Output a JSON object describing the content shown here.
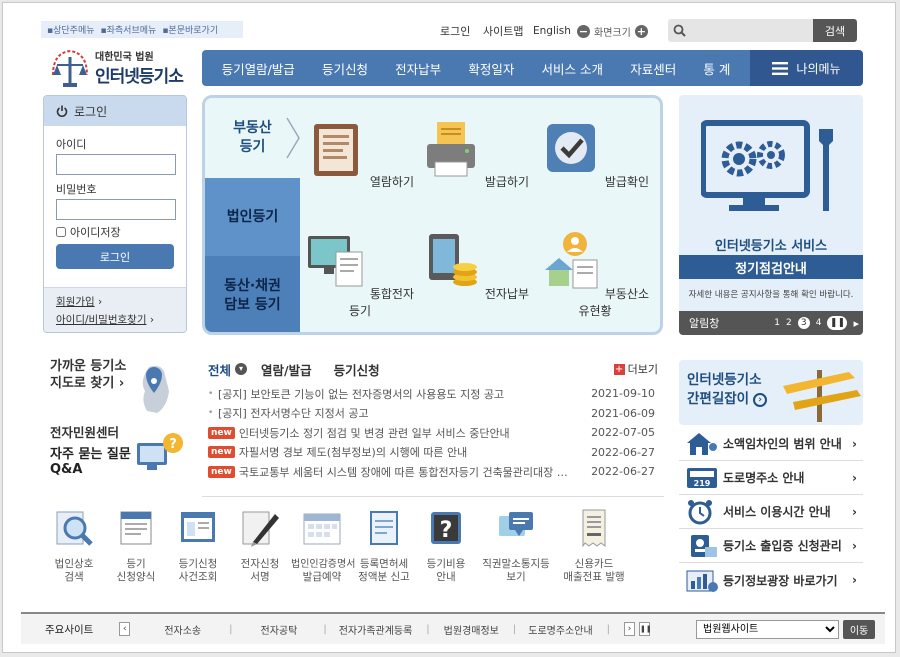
{
  "skip_links": [
    "상단주메뉴",
    "좌측서브메뉴",
    "본문바로가기"
  ],
  "utility": {
    "login": "로그인",
    "sitemap": "사이트맵",
    "english": "English",
    "zoom_label": "화면크기",
    "search_button": "검색",
    "search_placeholder": ""
  },
  "logo": {
    "top": "대한민국 법원",
    "main": "인터넷등기소"
  },
  "gnb": [
    "등기열람/발급",
    "등기신청",
    "전자납부",
    "확정일자",
    "서비스 소개",
    "자료센터",
    "통 계"
  ],
  "my_menu": "나의메뉴",
  "login_box": {
    "title": "로그인",
    "id_label": "아이디",
    "pw_label": "비밀번호",
    "save_id": "아이디저장",
    "button": "로그인",
    "join": "회원가입",
    "find": "아이디/비밀번호찾기"
  },
  "center": {
    "tabs": [
      "부동산\n등기",
      "법인등기",
      "동산·채권\n담보 등기"
    ],
    "services": [
      "열람하기",
      "발급하기",
      "발급확인",
      "통합전자등기",
      "전자납부",
      "부동산소유현황"
    ]
  },
  "banner": {
    "title": "인터넷등기소 서비스",
    "subtitle": "정기점검안내",
    "desc": "자세한 내용은 공지사항을 통해 확인 바랍니다.",
    "notice": "알림창",
    "pages": [
      "1",
      "2",
      "3",
      "4"
    ]
  },
  "near": {
    "line1": "가까운 등기소",
    "line2": "지도로 찾기"
  },
  "help": {
    "line1": "전자민원센터",
    "line2": "자주 묻는 질문",
    "line3": "Q&A"
  },
  "news": {
    "tabs": [
      "전체",
      "열람/발급",
      "등기신청"
    ],
    "more": "더보기",
    "items": [
      {
        "new": false,
        "title": "[공지] 보안토큰 기능이 없는 전자증명서의 사용용도 지정 공고",
        "date": "2021-09-10"
      },
      {
        "new": false,
        "title": "[공지] 전자서명수단 지정서 공고",
        "date": "2021-06-09"
      },
      {
        "new": true,
        "title": "인터넷등기소 정기 점검 및 변경 관련 일부 서비스 중단안내",
        "date": "2022-07-05"
      },
      {
        "new": true,
        "title": "자필서명 경보 제도(첨부정보)의 시행에 따른 안내",
        "date": "2022-06-27"
      },
      {
        "new": true,
        "title": "국토교통부 세움터 시스템 장애에 따른 통합전자등기 건축물관리대장 …",
        "date": "2022-06-27"
      }
    ],
    "new_badge": "new"
  },
  "quick": [
    [
      "법인상호",
      "검색"
    ],
    [
      "등기",
      "신청양식"
    ],
    [
      "등기신청",
      "사건조회"
    ],
    [
      "전자신청",
      "서명"
    ],
    [
      "법인인감증명서",
      "발급예약"
    ],
    [
      "등록면허세",
      "정액분 신고"
    ],
    [
      "등기비용",
      "안내"
    ],
    [
      "직권말소통지등",
      "보기"
    ],
    [
      "신용카드",
      "매출전표 발행"
    ]
  ],
  "guide": {
    "line1": "인터넷등기소",
    "line2": "간편길잡이"
  },
  "right_links": [
    "소액임차인의 범위 안내",
    "도로명주소 안내",
    "서비스 이용시간 안내",
    "등기소 출입증 신청관리",
    "등기정보광장 바로가기"
  ],
  "footer": {
    "label": "주요사이트",
    "links": [
      "전자소송",
      "전자공탁",
      "전자가족관계등록",
      "법원경매정보",
      "도로명주소안내"
    ],
    "select": "법원웹사이트",
    "go": "이동"
  }
}
